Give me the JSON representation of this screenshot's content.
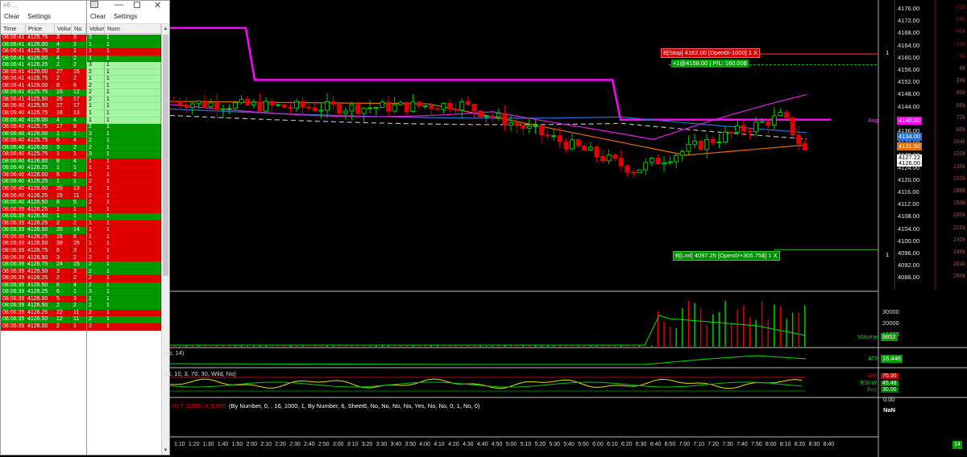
{
  "tape_left": {
    "title": "#6 ...",
    "menu": [
      "Clear",
      "Settings"
    ],
    "columns": [
      "Time",
      "Price",
      "Volun",
      "Nu"
    ],
    "rows": [
      [
        "08:06:41",
        "4125.75",
        "3",
        "3",
        "r"
      ],
      [
        "08:06:41",
        "4126.00",
        "4",
        "2",
        "g"
      ],
      [
        "08:06:41",
        "4125.75",
        "2",
        "1",
        "r"
      ],
      [
        "08:06:41",
        "4126.00",
        "4",
        "2",
        "g"
      ],
      [
        "08:06:41",
        "4126.25",
        "2",
        "2",
        "g"
      ],
      [
        "08:06:41",
        "4126.00",
        "27",
        "15",
        "r"
      ],
      [
        "08:06:41",
        "4125.75",
        "2",
        "2",
        "r"
      ],
      [
        "08:06:41",
        "4126.00",
        "8",
        "6",
        "r"
      ],
      [
        "08:06:41",
        "4125.75",
        "15",
        "12",
        "g"
      ],
      [
        "08:06:41",
        "4125.50",
        "26",
        "17",
        "r"
      ],
      [
        "08:06:40",
        "4125.50",
        "27",
        "17",
        "r"
      ],
      [
        "08:06:40",
        "4125.75",
        "18",
        "13",
        "r"
      ],
      [
        "08:06:40",
        "4126.00",
        "4",
        "4",
        "g"
      ],
      [
        "08:06:40",
        "4125.75",
        "17",
        "8",
        "r"
      ],
      [
        "08:06:40",
        "4126.00",
        "1",
        "1",
        "g"
      ],
      [
        "08:06:40",
        "4125.75",
        "6",
        "4",
        "r"
      ],
      [
        "08:06:40",
        "4126.00",
        "3",
        "2",
        "g"
      ],
      [
        "08:06:40",
        "4125.75",
        "1",
        "1",
        "r"
      ],
      [
        "08:06:40",
        "4126.00",
        "8",
        "4",
        "g"
      ],
      [
        "08:06:40",
        "4126.25",
        "1",
        "1",
        "g"
      ],
      [
        "08:06:40",
        "4126.00",
        "5",
        "3",
        "r"
      ],
      [
        "08:06:40",
        "4126.25",
        "1",
        "1",
        "g"
      ],
      [
        "08:06:40",
        "4126.00",
        "20",
        "13",
        "r"
      ],
      [
        "08:06:40",
        "4126.25",
        "15",
        "11",
        "r"
      ],
      [
        "08:06:40",
        "4126.50",
        "8",
        "5",
        "g"
      ],
      [
        "08:06:39",
        "4126.25",
        "1",
        "1",
        "r"
      ],
      [
        "08:06:39",
        "4126.50",
        "1",
        "1",
        "g"
      ],
      [
        "08:06:39",
        "4126.25",
        "2",
        "2",
        "r"
      ],
      [
        "08:06:39",
        "4126.50",
        "20",
        "14",
        "g"
      ],
      [
        "08:06:39",
        "4126.25",
        "15",
        "8",
        "r"
      ],
      [
        "08:06:39",
        "4126.50",
        "39",
        "26",
        "r"
      ],
      [
        "08:06:39",
        "4126.75",
        "6",
        "3",
        "r"
      ],
      [
        "08:06:39",
        "4126.50",
        "3",
        "2",
        "r"
      ],
      [
        "08:06:39",
        "4126.75",
        "24",
        "15",
        "g"
      ],
      [
        "08:06:39",
        "4126.50",
        "3",
        "3",
        "r"
      ],
      [
        "08:06:39",
        "4126.25",
        "2",
        "2",
        "r"
      ],
      [
        "08:06:39",
        "4126.50",
        "6",
        "4",
        "g"
      ],
      [
        "08:06:39",
        "4126.25",
        "6",
        "1",
        "g"
      ],
      [
        "08:06:39",
        "4126.00",
        "5",
        "3",
        "r"
      ],
      [
        "08:06:39",
        "4126.50",
        "2",
        "2",
        "g"
      ],
      [
        "08:06:39",
        "4126.25",
        "22",
        "11",
        "r"
      ],
      [
        "08:06:39",
        "4126.50",
        "12",
        "11",
        "g"
      ],
      [
        "08:06:39",
        "4126.00",
        "2",
        "1",
        "r"
      ]
    ]
  },
  "tape_right": {
    "menu": [
      "Clear",
      "Settings"
    ],
    "columns": [
      "Volun",
      "Num"
    ],
    "rows": [
      [
        "3",
        "1",
        "g"
      ],
      [
        "1",
        "1",
        "g"
      ],
      [
        "1",
        "1",
        "r"
      ],
      [
        "1",
        "1",
        "g"
      ],
      [
        "3",
        "1",
        "lg"
      ],
      [
        "2",
        "1",
        "lg"
      ],
      [
        "1",
        "1",
        "lg"
      ],
      [
        "2",
        "1",
        "lg"
      ],
      [
        "2",
        "1",
        "lg"
      ],
      [
        "2",
        "1",
        "lg"
      ],
      [
        "1",
        "1",
        "lg"
      ],
      [
        "1",
        "1",
        "lg"
      ],
      [
        "1",
        "1",
        "lg"
      ],
      [
        "2",
        "1",
        "g"
      ],
      [
        "3",
        "1",
        "g"
      ],
      [
        "2",
        "1",
        "g"
      ],
      [
        "2",
        "1",
        "g"
      ],
      [
        "3",
        "1",
        "g"
      ],
      [
        "1",
        "1",
        "r"
      ],
      [
        "1",
        "1",
        "r"
      ],
      [
        "1",
        "1",
        "r"
      ],
      [
        "2",
        "1",
        "r"
      ],
      [
        "2",
        "1",
        "r"
      ],
      [
        "2",
        "1",
        "r"
      ],
      [
        "2",
        "1",
        "r"
      ],
      [
        "1",
        "1",
        "r"
      ],
      [
        "1",
        "1",
        "g"
      ],
      [
        "1",
        "1",
        "r"
      ],
      [
        "1",
        "1",
        "r"
      ],
      [
        "1",
        "1",
        "r"
      ],
      [
        "1",
        "1",
        "r"
      ],
      [
        "1",
        "1",
        "r"
      ],
      [
        "2",
        "1",
        "r"
      ],
      [
        "2",
        "1",
        "g"
      ],
      [
        "2",
        "1",
        "g"
      ],
      [
        "2",
        "1",
        "r"
      ],
      [
        "2",
        "1",
        "g"
      ],
      [
        "3",
        "1",
        "g"
      ],
      [
        "1",
        "1",
        "g"
      ],
      [
        "2",
        "1",
        "g"
      ],
      [
        "2",
        "1",
        "r"
      ],
      [
        "2",
        "1",
        "g"
      ],
      [
        "2",
        "1",
        "r"
      ]
    ]
  },
  "price_axis": [
    "4176.00",
    "4172.00",
    "4168.00",
    "4164.00",
    "4160.00",
    "4156.00",
    "4152.00",
    "4148.00",
    "4144.00",
    "4140.00",
    "4136.00",
    "4132.00",
    "4128.00",
    "4124.00",
    "4120.00",
    "4116.00",
    "4112.00",
    "4108.00",
    "4104.00",
    "4100.00",
    "4096.00",
    "4092.00",
    "4088.00"
  ],
  "volume_profile": [
    "-72k",
    "-56k",
    "-40k",
    "-24k",
    "-8k",
    "8k",
    "24k",
    "40k",
    "56k",
    "72k",
    "88k",
    "104k",
    "120k",
    "136k",
    "152k",
    "168k",
    "184k",
    "200k",
    "216k",
    "232k",
    "248k",
    "264k",
    "280k"
  ],
  "price_tags": {
    "avg_label": "Avg",
    "avg": "4140.00",
    "blue": "4134.00",
    "orange": "4131.50",
    "white1": "4127.22",
    "white2": "4126.00"
  },
  "orders": {
    "stop": "B[Stop] 4162.00 [Open0/-1000] 1 X",
    "position": "+1@4158.00 | P/L: 160.00$",
    "limit": "B[Lmt] 4097.25 [Open0/+305.75$] 1 X",
    "stop_qty": "1",
    "limit_qty": "1"
  },
  "volume_panel": {
    "ticks": [
      "30000",
      "20000",
      "10000"
    ],
    "label": "Volume",
    "value": "8852"
  },
  "atr_panel": {
    "params": "mp, 14)",
    "label": "ATR",
    "value": "16.446"
  },
  "rsi_panel": {
    "params": "ast, 10, 3, 70, 30, Wild, No)",
    "labels": [
      "RSI-W",
      "Sell",
      "Buy"
    ],
    "values": [
      "70.00",
      "45.48",
      "30.00"
    ],
    "axis": "0.00"
  },
  "last_panel": {
    "prefix": "00  T: 0.000  U: 0.000",
    "params": "(By Number, 0, , 16, 1000, 1, By Number, 6, Sheet6, No, No, No, No, Yes, No, No, 0, 1, No, 0)",
    "nan": "NaN"
  },
  "time_axis": [
    "1:10",
    "1:20",
    "1:30",
    "1:40",
    "1:50",
    "2:00",
    "2:10",
    "2:20",
    "2:30",
    "2:40",
    "2:50",
    "3:00",
    "3:10",
    "3:20",
    "3:30",
    "3:40",
    "3:50",
    "4:00",
    "4:10",
    "4:20",
    "4:30",
    "4:40",
    "4:50",
    "5:00",
    "5:10",
    "5:20",
    "5:30",
    "5:40",
    "5:50",
    "6:00",
    "6:10",
    "6:20",
    "6:30",
    "6:40",
    "6:50",
    "7:00",
    "7:10",
    "7:20",
    "7:30",
    "7:40",
    "7:50",
    "8:00",
    "8:10",
    "8:20",
    "8:30",
    "8:40"
  ],
  "corner_badge": "14",
  "colors": {
    "up": "#00c800",
    "down": "#e00000",
    "magenta": "#ff00ff",
    "blue": "#2266cc",
    "orange": "#e07000"
  }
}
